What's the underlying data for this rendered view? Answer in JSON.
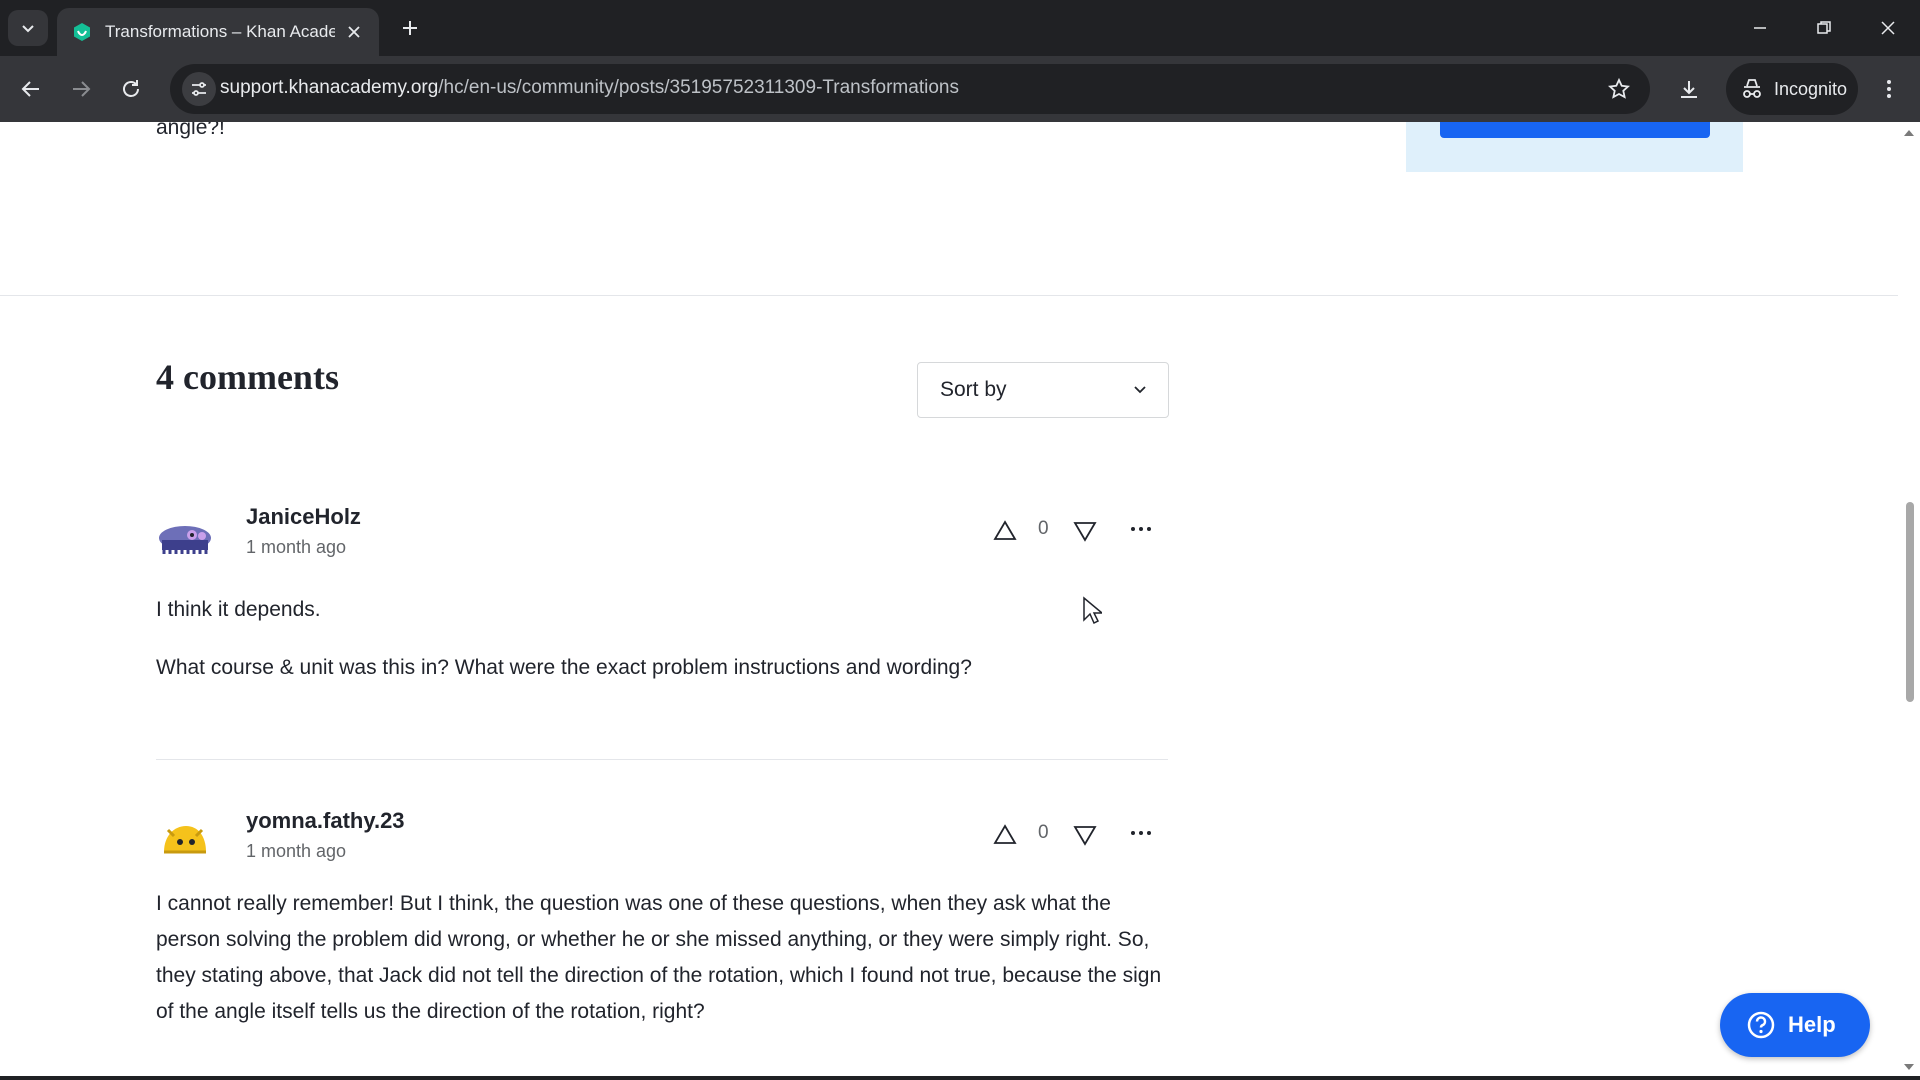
{
  "browser": {
    "tab_title": "Transformations – Khan Academ",
    "url_host": "support.khanacademy.org",
    "url_path": "/hc/en-us/community/posts/35195752311309-Transformations",
    "incognito_label": "Incognito"
  },
  "page": {
    "prev_post_tail": "angle?!",
    "comments_heading": "4 comments",
    "sort_label": "Sort by",
    "help_label": "Help",
    "colors": {
      "accent": "#1865f2",
      "side_box": "#dff0fb"
    }
  },
  "comments": [
    {
      "author": "JaniceHolz",
      "time": "1 month ago",
      "votes": "0",
      "avatar_icon": "monster-avatar-icon",
      "paragraphs": [
        "I think it depends.",
        "What course & unit was this in?  What were the exact problem instructions and wording?"
      ]
    },
    {
      "author": "yomna.fathy.23",
      "time": "1 month ago",
      "votes": "0",
      "avatar_icon": "blob-avatar-icon",
      "paragraphs": [
        "I cannot really remember! But I think, the question was one of these questions, when they ask what the person solving the problem did wrong, or whether he or she missed anything, or they were simply right. So, they stating above, that Jack did not tell the direction of the rotation, which I found not true, because the sign of the angle itself tells us the direction of the rotation, right?"
      ]
    }
  ]
}
